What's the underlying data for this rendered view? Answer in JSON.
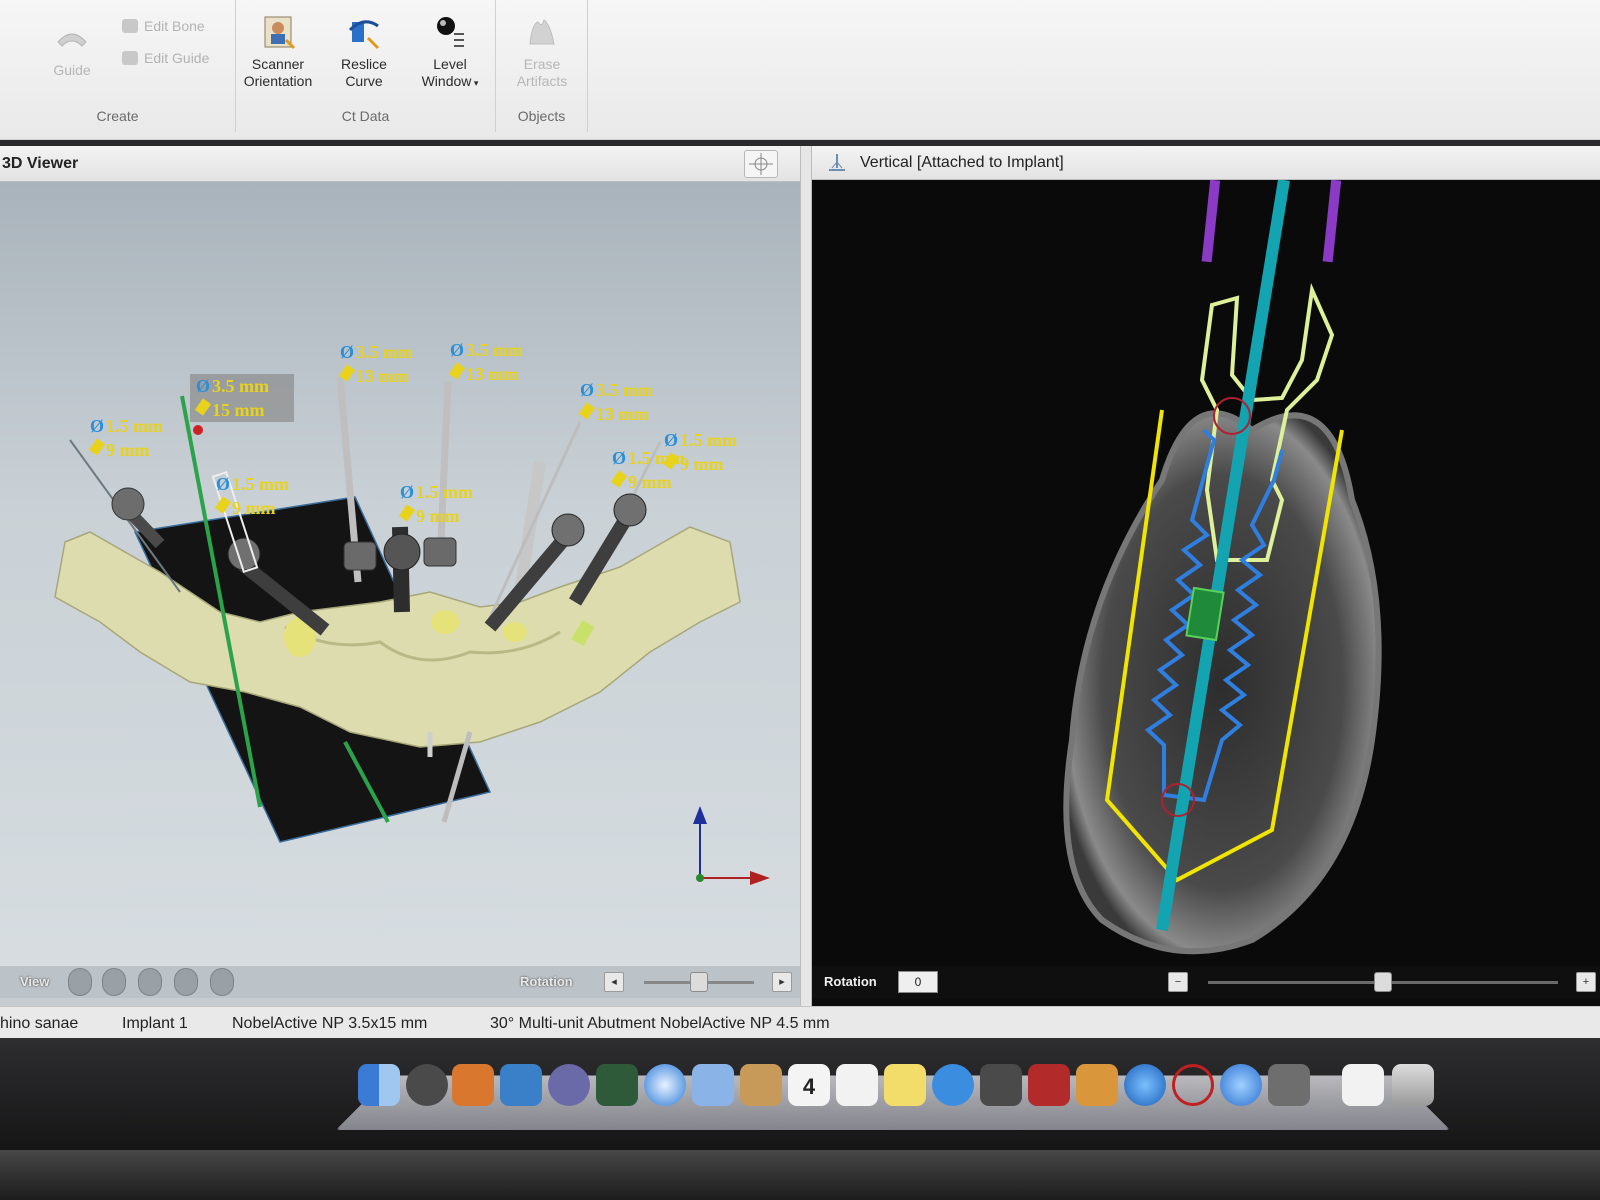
{
  "ribbon": {
    "create": {
      "group_label": "Create",
      "guide_label": "Guide",
      "edit_bone_label": "Edit Bone",
      "edit_guide_label": "Edit Guide"
    },
    "ct_data": {
      "group_label": "Ct Data",
      "scanner_orientation_line1": "Scanner",
      "scanner_orientation_line2": "Orientation",
      "reslice_curve_line1": "Reslice",
      "reslice_curve_line2": "Curve",
      "level_window_line1": "Level",
      "level_window_line2": "Window"
    },
    "objects": {
      "group_label": "Objects",
      "erase_artifacts_line1": "Erase",
      "erase_artifacts_line2": "Artifacts"
    }
  },
  "viewer3d": {
    "title": "3D Viewer",
    "view_label": "View",
    "rotation_label": "Rotation",
    "annotations": [
      {
        "d": "1.5 mm",
        "l": "9 mm"
      },
      {
        "d": "3.5 mm",
        "l": "15 mm"
      },
      {
        "d": "1.5 mm",
        "l": "9 mm"
      },
      {
        "d": "3.5 mm",
        "l": "13 mm"
      },
      {
        "d": "3.5 mm",
        "l": "13 mm"
      },
      {
        "d": "1.5 mm",
        "l": "9 mm"
      },
      {
        "d": "3.5 mm",
        "l": "13 mm"
      },
      {
        "d": "1.5 mm",
        "l": "9 mm"
      },
      {
        "d": "1.5 mm",
        "l": "9 mm"
      }
    ]
  },
  "ctview": {
    "title": "Vertical [Attached to Implant]",
    "rotation_label": "Rotation",
    "rotation_value": "0"
  },
  "status": {
    "patient": "hino sanae",
    "implant": "Implant 1",
    "implant_model": "NobelActive NP 3.5x15 mm",
    "abutment": "30° Multi-unit Abutment NobelActive NP 4.5 mm"
  },
  "dock": {
    "calendar_day": "4"
  },
  "colors": {
    "annotation_text": "#e8d21c",
    "diameter_icon": "#2a8fd8",
    "implant_outline": "#2f7fe0",
    "abutment_outline": "#dff09a",
    "guide_outline": "#f0e400",
    "axis_line": "#14a3b0",
    "sleeve": "#8a3ac4",
    "bone_3d": "#dcdcae"
  }
}
